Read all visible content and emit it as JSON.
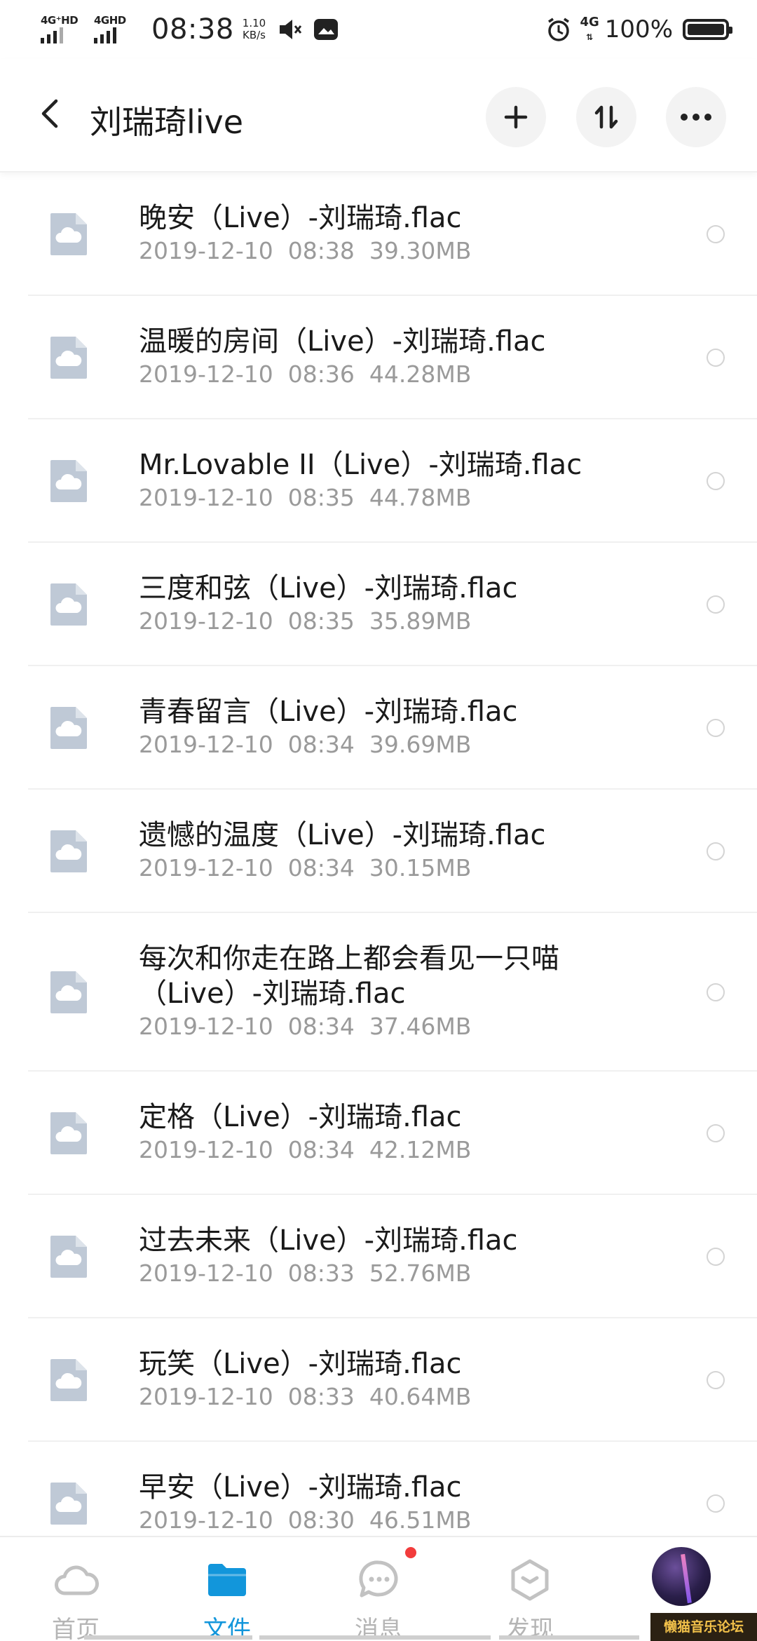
{
  "status_bar": {
    "sim1": "4G⁺HD",
    "sim2": "4GHD",
    "time": "08:38",
    "speed_value": "1.10",
    "speed_unit": "KB/s",
    "network": "4G",
    "battery": "100%"
  },
  "header": {
    "title": "刘瑞琦live",
    "icons": [
      "back-icon",
      "plus-icon",
      "sort-icon",
      "more-icon"
    ]
  },
  "files": [
    {
      "name": "晚安（Live）-刘瑞琦.flac",
      "date": "2019-12-10",
      "time": "08:38",
      "size": "39.30MB"
    },
    {
      "name": "温暖的房间（Live）-刘瑞琦.flac",
      "date": "2019-12-10",
      "time": "08:36",
      "size": "44.28MB"
    },
    {
      "name": "Mr.Lovable II（Live）-刘瑞琦.flac",
      "date": "2019-12-10",
      "time": "08:35",
      "size": "44.78MB"
    },
    {
      "name": "三度和弦（Live）-刘瑞琦.flac",
      "date": "2019-12-10",
      "time": "08:35",
      "size": "35.89MB"
    },
    {
      "name": "青春留言（Live）-刘瑞琦.flac",
      "date": "2019-12-10",
      "time": "08:34",
      "size": "39.69MB"
    },
    {
      "name": "遗憾的温度（Live）-刘瑞琦.flac",
      "date": "2019-12-10",
      "time": "08:34",
      "size": "30.15MB"
    },
    {
      "name": "每次和你走在路上都会看见一只喵（Live）-刘瑞琦.flac",
      "name_line1": "每次和你走在路上都会看见一只喵",
      "name_line2": "（Live）-刘瑞琦.flac",
      "date": "2019-12-10",
      "time": "08:34",
      "size": "37.46MB"
    },
    {
      "name": "定格（Live）-刘瑞琦.flac",
      "date": "2019-12-10",
      "time": "08:34",
      "size": "42.12MB"
    },
    {
      "name": "过去未来（Live）-刘瑞琦.flac",
      "date": "2019-12-10",
      "time": "08:33",
      "size": "52.76MB"
    },
    {
      "name": "玩笑（Live）-刘瑞琦.flac",
      "date": "2019-12-10",
      "time": "08:33",
      "size": "40.64MB"
    },
    {
      "name": "早安（Live）-刘瑞琦.flac",
      "date": "2019-12-10",
      "time": "08:30",
      "size": "46.51MB"
    }
  ],
  "bottom_nav": {
    "items": [
      {
        "label": "首页",
        "icon": "cloud-icon"
      },
      {
        "label": "文件",
        "icon": "folder-icon",
        "active": true
      },
      {
        "label": "消息",
        "icon": "chat-icon",
        "badge": true
      },
      {
        "label": "发现",
        "icon": "discover-icon"
      }
    ]
  },
  "watermark": "懒猫音乐论坛",
  "colors": {
    "accent": "#1296db",
    "text": "#1a1a1a",
    "meta": "#9a9a9a",
    "file_icon": "#bfc9d6",
    "badge": "#f23c3c"
  }
}
